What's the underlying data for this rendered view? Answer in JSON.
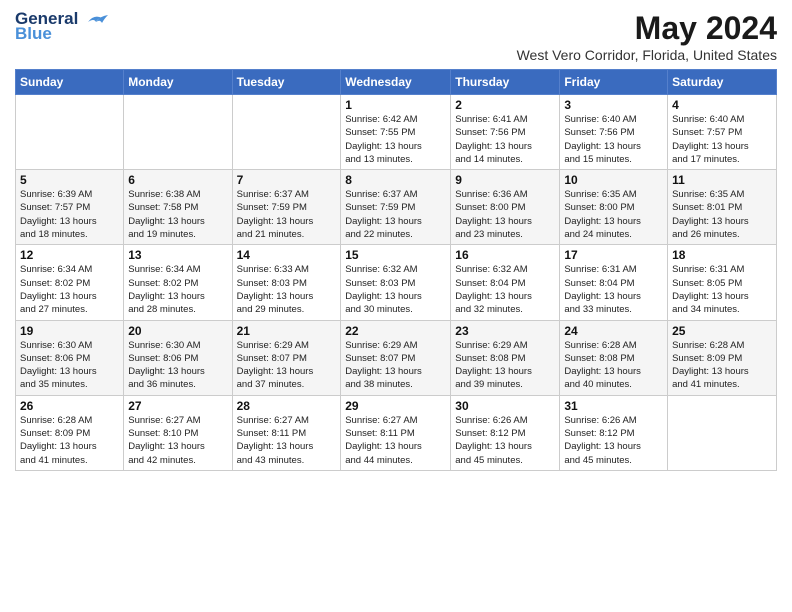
{
  "logo": {
    "line1": "General",
    "line2": "Blue"
  },
  "title": "May 2024",
  "subtitle": "West Vero Corridor, Florida, United States",
  "weekdays": [
    "Sunday",
    "Monday",
    "Tuesday",
    "Wednesday",
    "Thursday",
    "Friday",
    "Saturday"
  ],
  "weeks": [
    [
      {
        "day": "",
        "info": ""
      },
      {
        "day": "",
        "info": ""
      },
      {
        "day": "",
        "info": ""
      },
      {
        "day": "1",
        "info": "Sunrise: 6:42 AM\nSunset: 7:55 PM\nDaylight: 13 hours\nand 13 minutes."
      },
      {
        "day": "2",
        "info": "Sunrise: 6:41 AM\nSunset: 7:56 PM\nDaylight: 13 hours\nand 14 minutes."
      },
      {
        "day": "3",
        "info": "Sunrise: 6:40 AM\nSunset: 7:56 PM\nDaylight: 13 hours\nand 15 minutes."
      },
      {
        "day": "4",
        "info": "Sunrise: 6:40 AM\nSunset: 7:57 PM\nDaylight: 13 hours\nand 17 minutes."
      }
    ],
    [
      {
        "day": "5",
        "info": "Sunrise: 6:39 AM\nSunset: 7:57 PM\nDaylight: 13 hours\nand 18 minutes."
      },
      {
        "day": "6",
        "info": "Sunrise: 6:38 AM\nSunset: 7:58 PM\nDaylight: 13 hours\nand 19 minutes."
      },
      {
        "day": "7",
        "info": "Sunrise: 6:37 AM\nSunset: 7:59 PM\nDaylight: 13 hours\nand 21 minutes."
      },
      {
        "day": "8",
        "info": "Sunrise: 6:37 AM\nSunset: 7:59 PM\nDaylight: 13 hours\nand 22 minutes."
      },
      {
        "day": "9",
        "info": "Sunrise: 6:36 AM\nSunset: 8:00 PM\nDaylight: 13 hours\nand 23 minutes."
      },
      {
        "day": "10",
        "info": "Sunrise: 6:35 AM\nSunset: 8:00 PM\nDaylight: 13 hours\nand 24 minutes."
      },
      {
        "day": "11",
        "info": "Sunrise: 6:35 AM\nSunset: 8:01 PM\nDaylight: 13 hours\nand 26 minutes."
      }
    ],
    [
      {
        "day": "12",
        "info": "Sunrise: 6:34 AM\nSunset: 8:02 PM\nDaylight: 13 hours\nand 27 minutes."
      },
      {
        "day": "13",
        "info": "Sunrise: 6:34 AM\nSunset: 8:02 PM\nDaylight: 13 hours\nand 28 minutes."
      },
      {
        "day": "14",
        "info": "Sunrise: 6:33 AM\nSunset: 8:03 PM\nDaylight: 13 hours\nand 29 minutes."
      },
      {
        "day": "15",
        "info": "Sunrise: 6:32 AM\nSunset: 8:03 PM\nDaylight: 13 hours\nand 30 minutes."
      },
      {
        "day": "16",
        "info": "Sunrise: 6:32 AM\nSunset: 8:04 PM\nDaylight: 13 hours\nand 32 minutes."
      },
      {
        "day": "17",
        "info": "Sunrise: 6:31 AM\nSunset: 8:04 PM\nDaylight: 13 hours\nand 33 minutes."
      },
      {
        "day": "18",
        "info": "Sunrise: 6:31 AM\nSunset: 8:05 PM\nDaylight: 13 hours\nand 34 minutes."
      }
    ],
    [
      {
        "day": "19",
        "info": "Sunrise: 6:30 AM\nSunset: 8:06 PM\nDaylight: 13 hours\nand 35 minutes."
      },
      {
        "day": "20",
        "info": "Sunrise: 6:30 AM\nSunset: 8:06 PM\nDaylight: 13 hours\nand 36 minutes."
      },
      {
        "day": "21",
        "info": "Sunrise: 6:29 AM\nSunset: 8:07 PM\nDaylight: 13 hours\nand 37 minutes."
      },
      {
        "day": "22",
        "info": "Sunrise: 6:29 AM\nSunset: 8:07 PM\nDaylight: 13 hours\nand 38 minutes."
      },
      {
        "day": "23",
        "info": "Sunrise: 6:29 AM\nSunset: 8:08 PM\nDaylight: 13 hours\nand 39 minutes."
      },
      {
        "day": "24",
        "info": "Sunrise: 6:28 AM\nSunset: 8:08 PM\nDaylight: 13 hours\nand 40 minutes."
      },
      {
        "day": "25",
        "info": "Sunrise: 6:28 AM\nSunset: 8:09 PM\nDaylight: 13 hours\nand 41 minutes."
      }
    ],
    [
      {
        "day": "26",
        "info": "Sunrise: 6:28 AM\nSunset: 8:09 PM\nDaylight: 13 hours\nand 41 minutes."
      },
      {
        "day": "27",
        "info": "Sunrise: 6:27 AM\nSunset: 8:10 PM\nDaylight: 13 hours\nand 42 minutes."
      },
      {
        "day": "28",
        "info": "Sunrise: 6:27 AM\nSunset: 8:11 PM\nDaylight: 13 hours\nand 43 minutes."
      },
      {
        "day": "29",
        "info": "Sunrise: 6:27 AM\nSunset: 8:11 PM\nDaylight: 13 hours\nand 44 minutes."
      },
      {
        "day": "30",
        "info": "Sunrise: 6:26 AM\nSunset: 8:12 PM\nDaylight: 13 hours\nand 45 minutes."
      },
      {
        "day": "31",
        "info": "Sunrise: 6:26 AM\nSunset: 8:12 PM\nDaylight: 13 hours\nand 45 minutes."
      },
      {
        "day": "",
        "info": ""
      }
    ]
  ]
}
